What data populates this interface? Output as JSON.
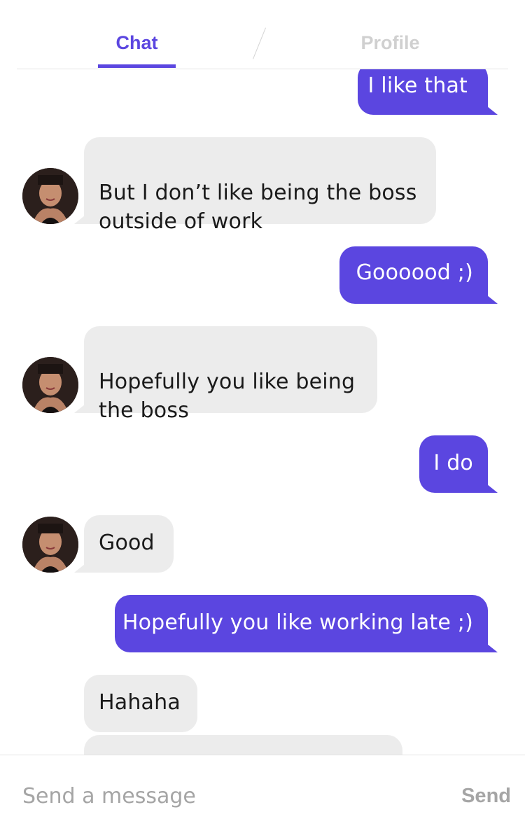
{
  "tabs": [
    {
      "label": "Chat",
      "active": true
    },
    {
      "label": "Profile",
      "active": false
    }
  ],
  "messages": [
    {
      "from": "me",
      "text": "I like that"
    },
    {
      "from": "them",
      "text": "But I don’t like being the boss\noutside of work"
    },
    {
      "from": "me",
      "text": "Goooood ;)"
    },
    {
      "from": "them",
      "text": "Hopefully you like being\nthe boss"
    },
    {
      "from": "me",
      "text": "I do"
    },
    {
      "from": "them",
      "text": "Good"
    },
    {
      "from": "me",
      "text": "Hopefully you like working late ;)"
    },
    {
      "from": "them",
      "text": "Hahaha"
    },
    {
      "from": "them",
      "text": ""
    }
  ],
  "composer": {
    "placeholder": "Send a message",
    "send_label": "Send"
  },
  "colors": {
    "accent": "#5b46e0",
    "received_bubble": "#ececec",
    "inactive_tab": "#d0d0d0",
    "placeholder": "#a5a5a5"
  }
}
